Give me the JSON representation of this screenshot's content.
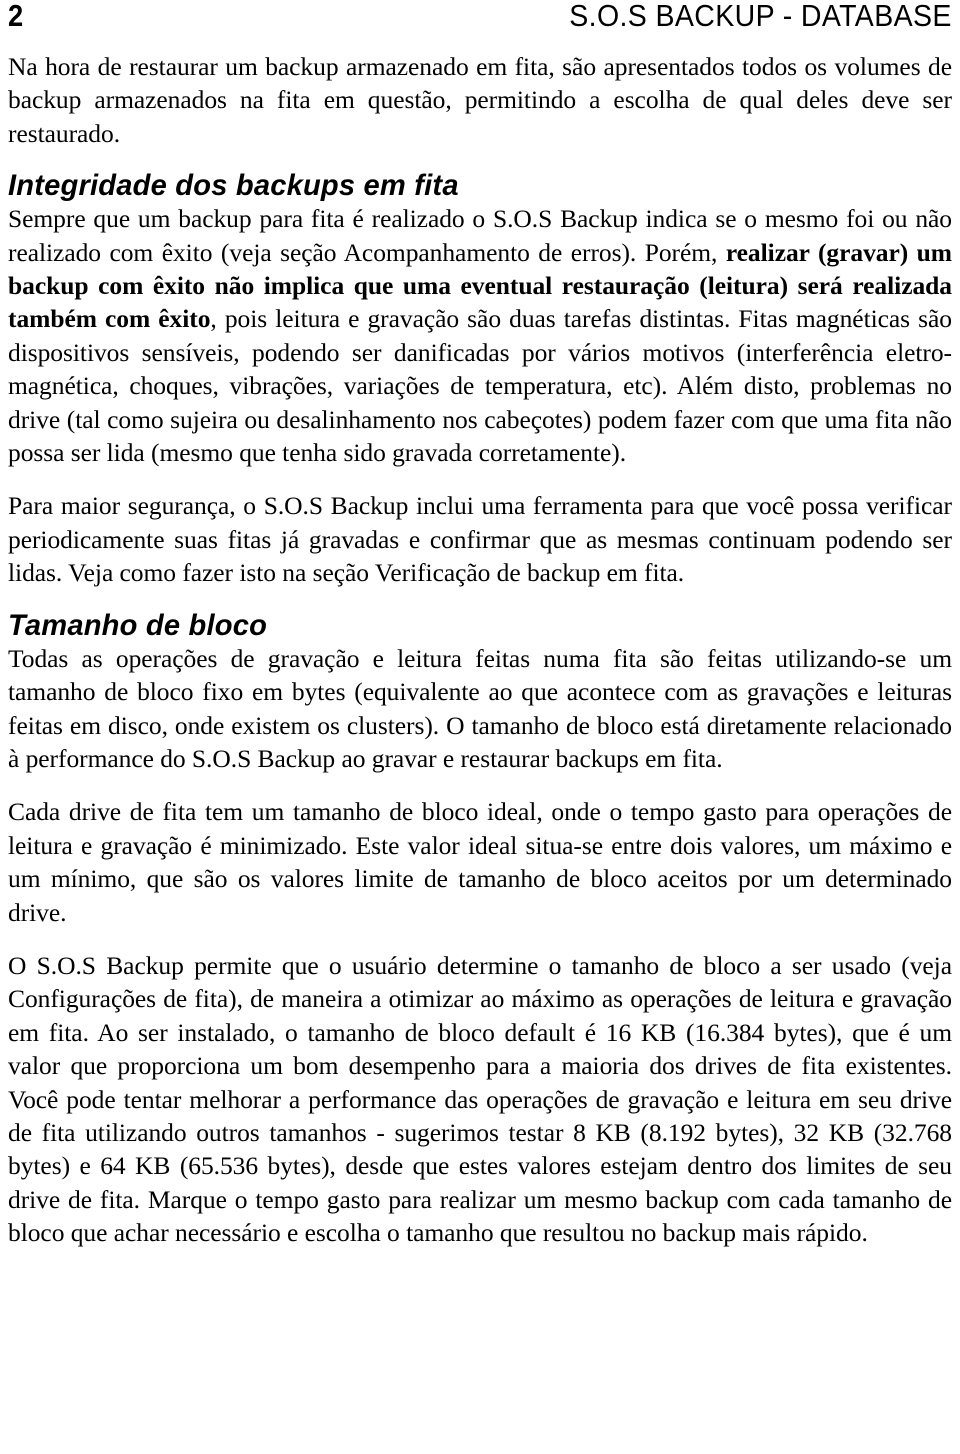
{
  "header": {
    "page_number": "2",
    "title": "S.O.S BACKUP - DATABASE"
  },
  "content": {
    "intro_paragraph": "Na hora de restaurar um backup armazenado em fita, são apresentados todos os volumes de backup armazenados na fita em questão, permitindo a escolha de qual deles deve ser restaurado.",
    "section_1": {
      "heading": "Integridade dos backups em fita",
      "paragraph_1_part_1": "Sempre que um backup para fita é realizado o S.O.S Backup indica se o mesmo foi ou não realizado com êxito (veja seção Acompanhamento de erros). Porém, ",
      "paragraph_1_bold": "realizar (gravar) um backup com êxito não implica que uma eventual restauração (leitura) será realizada também com êxito",
      "paragraph_1_part_2": ", pois leitura e gravação são duas tarefas distintas. Fitas magnéticas são dispositivos sensíveis, podendo ser danificadas por vários motivos (interferência eletro-magnética, choques, vibrações, variações de temperatura, etc). Além disto, problemas no drive (tal como sujeira ou desalinhamento nos cabeçotes) podem fazer com que uma fita não possa ser lida (mesmo que tenha sido gravada corretamente).",
      "paragraph_2": "Para maior segurança, o S.O.S Backup inclui uma ferramenta para que você possa verificar periodicamente suas fitas já gravadas e confirmar que as mesmas continuam podendo ser lidas. Veja como fazer isto na seção Verificação de backup em fita."
    },
    "section_2": {
      "heading": "Tamanho de bloco",
      "paragraph_1": "Todas as operações de gravação e leitura feitas numa fita são feitas utilizando-se um tamanho de bloco fixo em bytes (equivalente ao que acontece com as gravações e leituras feitas em disco, onde existem os clusters). O tamanho de bloco está diretamente relacionado à performance do S.O.S Backup ao gravar e restaurar backups em fita.",
      "paragraph_2": "Cada drive de fita tem um tamanho de bloco ideal, onde o tempo gasto para operações de leitura e gravação é minimizado. Este valor ideal situa-se entre dois valores, um máximo e um mínimo, que são os valores limite de tamanho de bloco aceitos por um determinado drive.",
      "paragraph_3": "O S.O.S Backup permite que o usuário determine o tamanho de bloco a ser usado (veja Configurações de fita), de maneira a otimizar ao máximo as operações de leitura e gravação em fita. Ao ser instalado, o tamanho de bloco default é 16 KB (16.384 bytes), que é um valor que proporciona um bom desempenho para a maioria dos drives de fita existentes. Você pode tentar melhorar a performance das operações de gravação e leitura em seu drive de fita utilizando outros tamanhos - sugerimos testar 8 KB (8.192 bytes), 32 KB (32.768 bytes) e 64 KB (65.536 bytes), desde que estes valores estejam dentro dos limites de seu drive de fita. Marque o tempo gasto para realizar um mesmo backup com cada tamanho de bloco que achar necessário e escolha o tamanho que resultou no backup mais rápido."
    }
  },
  "colors": {
    "text": "#000000",
    "background": "#ffffff"
  }
}
